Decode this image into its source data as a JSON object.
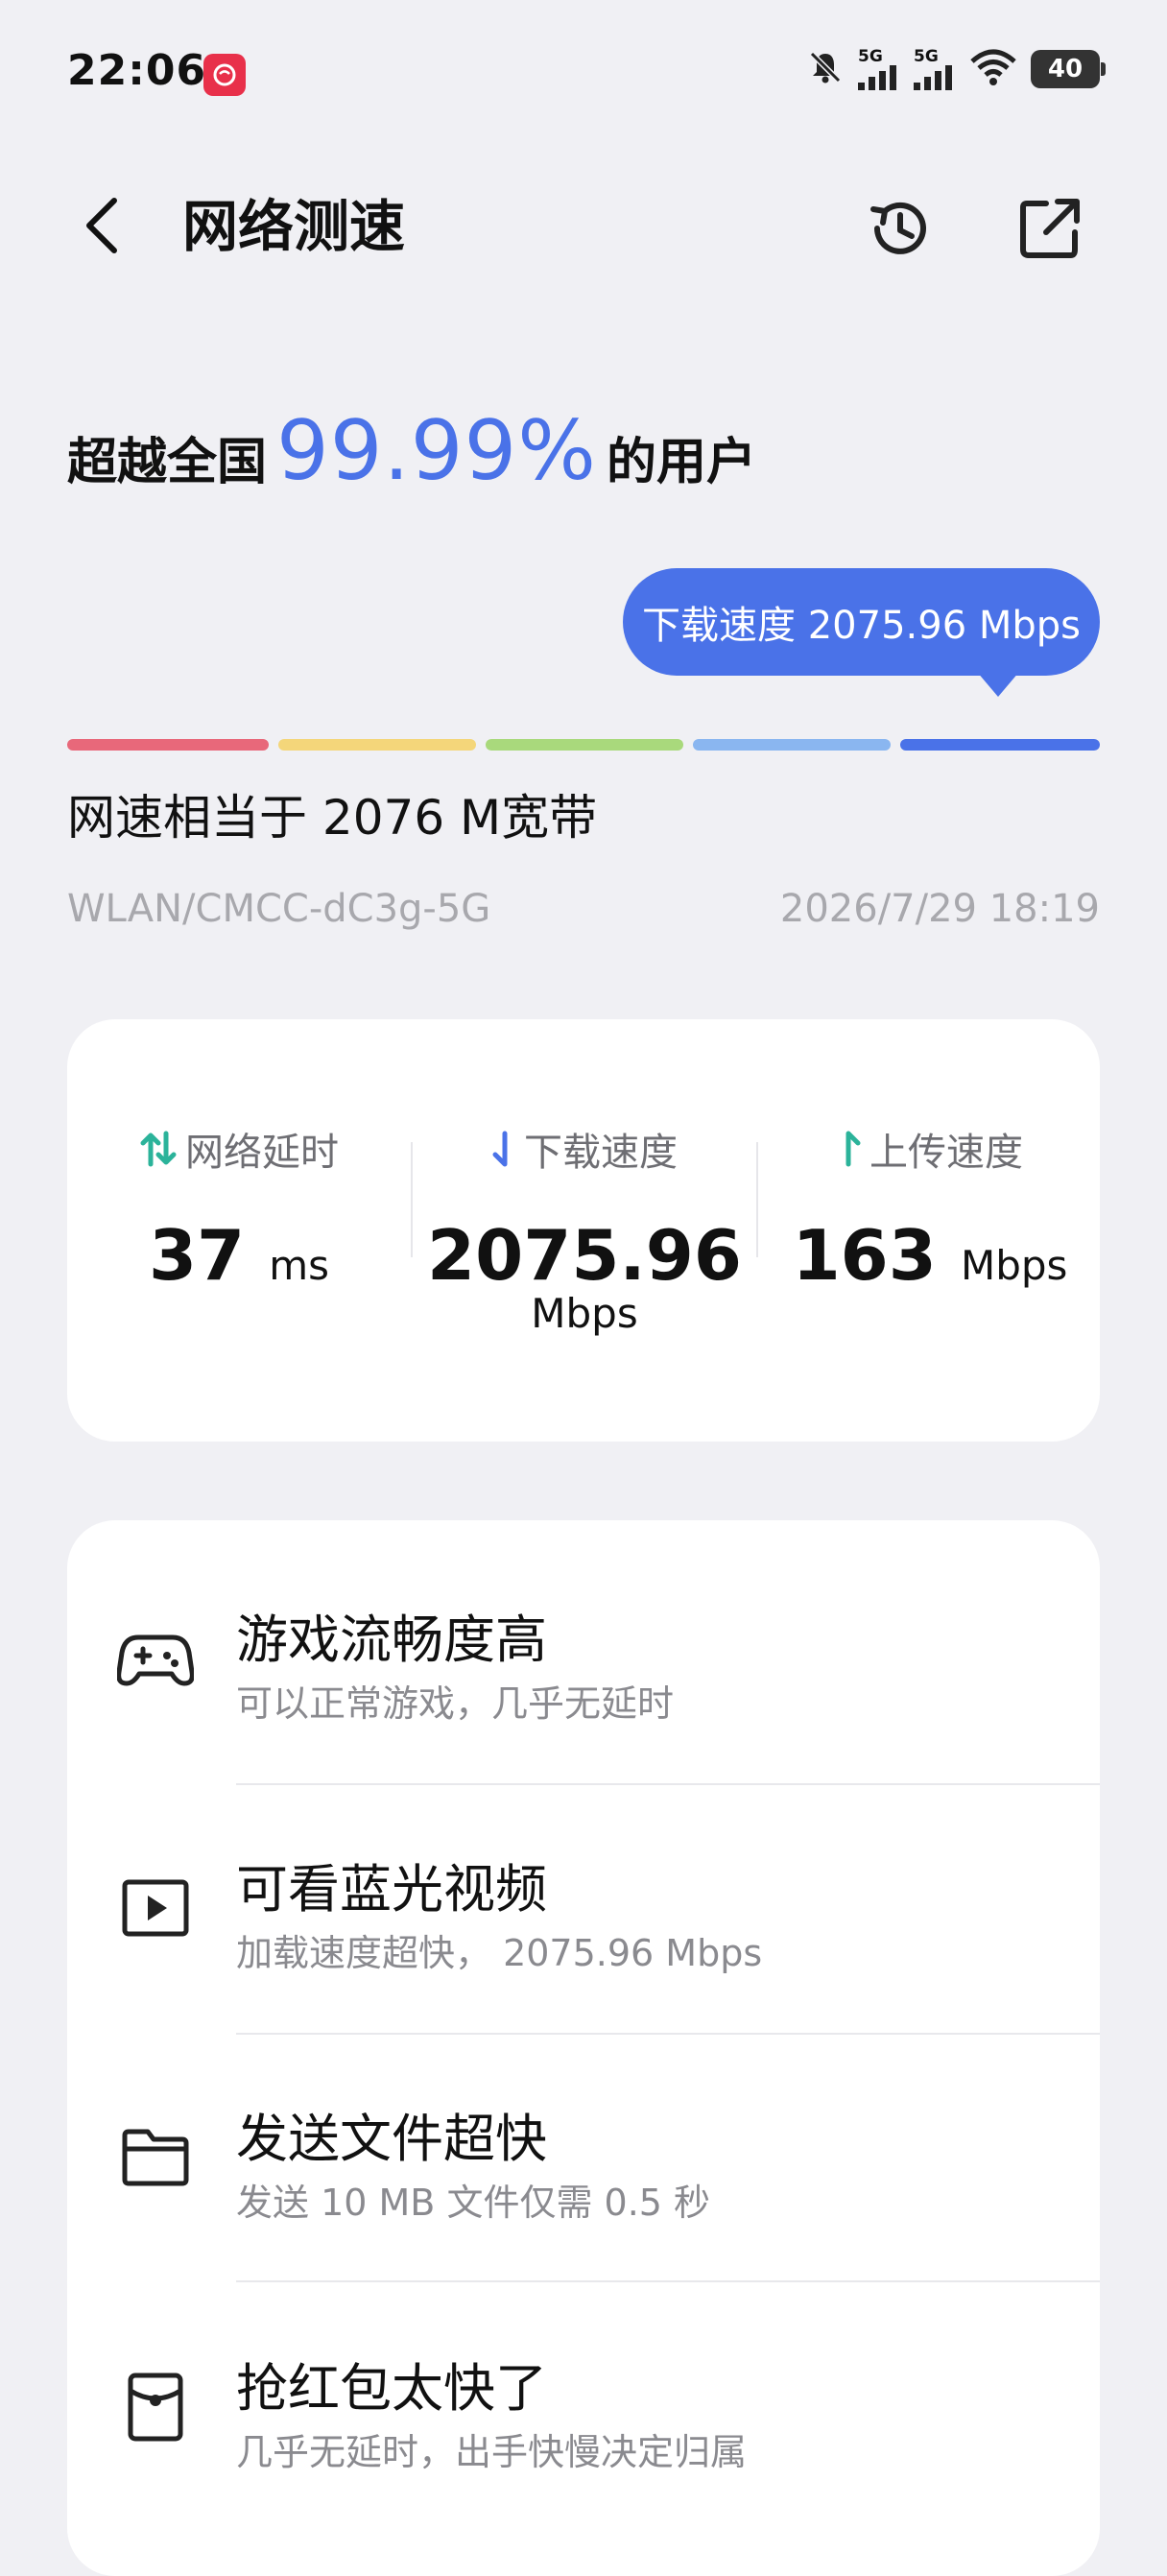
{
  "status_bar": {
    "time": "22:06",
    "network_labels": [
      "5G",
      "5G"
    ],
    "battery": "40",
    "icons": [
      "app-badge-icon",
      "mute-icon",
      "signal-icon",
      "signal-icon",
      "wifi-icon",
      "battery-icon"
    ]
  },
  "header": {
    "title": "网络测速",
    "back_icon": "chevron-left-icon",
    "history_icon": "history-icon",
    "share_icon": "share-icon"
  },
  "result": {
    "prefix": "超越全国",
    "percent": "99.99%",
    "suffix": "的用户",
    "bubble": "下载速度 2075.96 Mbps",
    "equivalent": "网速相当于 2076 M宽带",
    "connection": "WLAN/CMCC-dC3g-5G",
    "datetime": "2026/7/29 18:19",
    "level_colors": [
      "#e8687a",
      "#f4d67a",
      "#a9d97c",
      "#8ab6f0",
      "#4a72e8"
    ],
    "active_level": 5
  },
  "metrics": [
    {
      "label": "网络延时",
      "value": "37",
      "unit": "ms",
      "icon": "latency-arrows-icon",
      "color": "#2bb39a"
    },
    {
      "label": "下载速度",
      "value": "2075.96",
      "unit": "Mbps",
      "icon": "download-arrow-icon",
      "color": "#4a72e8"
    },
    {
      "label": "上传速度",
      "value": "163",
      "unit": "Mbps",
      "icon": "upload-arrow-icon",
      "color": "#2bb39a"
    }
  ],
  "features": [
    {
      "title": "游戏流畅度高",
      "subtitle": "可以正常游戏，几乎无延时",
      "icon": "gamepad-icon"
    },
    {
      "title": "可看蓝光视频",
      "subtitle": "加载速度超快， 2075.96 Mbps",
      "icon": "video-play-icon"
    },
    {
      "title": "发送文件超快",
      "subtitle": "发送 10 MB 文件仅需 0.5 秒",
      "icon": "folder-icon"
    },
    {
      "title": "抢红包太快了",
      "subtitle": "几乎无延时，出手快慢决定归属",
      "icon": "red-packet-icon"
    }
  ]
}
